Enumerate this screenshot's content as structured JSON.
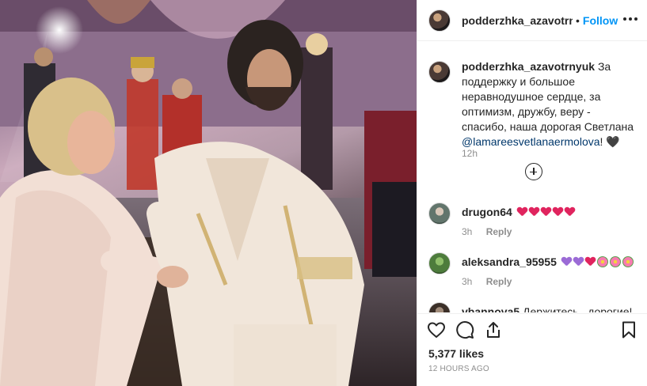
{
  "header": {
    "username": "podderzhka_azavotrnyuk",
    "separator": "•",
    "follow_label": "Follow"
  },
  "caption": {
    "username": "podderzhka_azavotrnyuk",
    "text": "За поддержку и большое неравнодушное сердце, за оптимизм, дружбу, веру - спасибо, наша дорогая Светлана",
    "mention": "@lamareesvetlanaermolova",
    "suffix": "! 🖤",
    "time": "12h"
  },
  "comments": [
    {
      "username": "drugon64",
      "emoji": [
        "heart",
        "heart",
        "heart",
        "heart",
        "heart"
      ],
      "time": "3h",
      "reply_label": "Reply"
    },
    {
      "username": "aleksandra_95955",
      "emoji": [
        "heart-purple",
        "heart-purple",
        "heart",
        "flower",
        "flower",
        "flower"
      ],
      "time": "3h",
      "reply_label": "Reply"
    },
    {
      "username": "vbannova5",
      "text": "Держитесь , дорогие!"
    }
  ],
  "footer": {
    "likes": "5,377 likes",
    "posted_ago": "12 HOURS AGO"
  },
  "icons": [
    "like-icon",
    "comment-icon",
    "share-icon",
    "bookmark-icon",
    "more-options-icon",
    "load-more-icon"
  ],
  "colors": {
    "link": "#0095f6",
    "mention": "#00376b",
    "heart_red": "#e0245e",
    "heart_purple": "#9b6bd6",
    "muted": "#8e8e8e"
  }
}
